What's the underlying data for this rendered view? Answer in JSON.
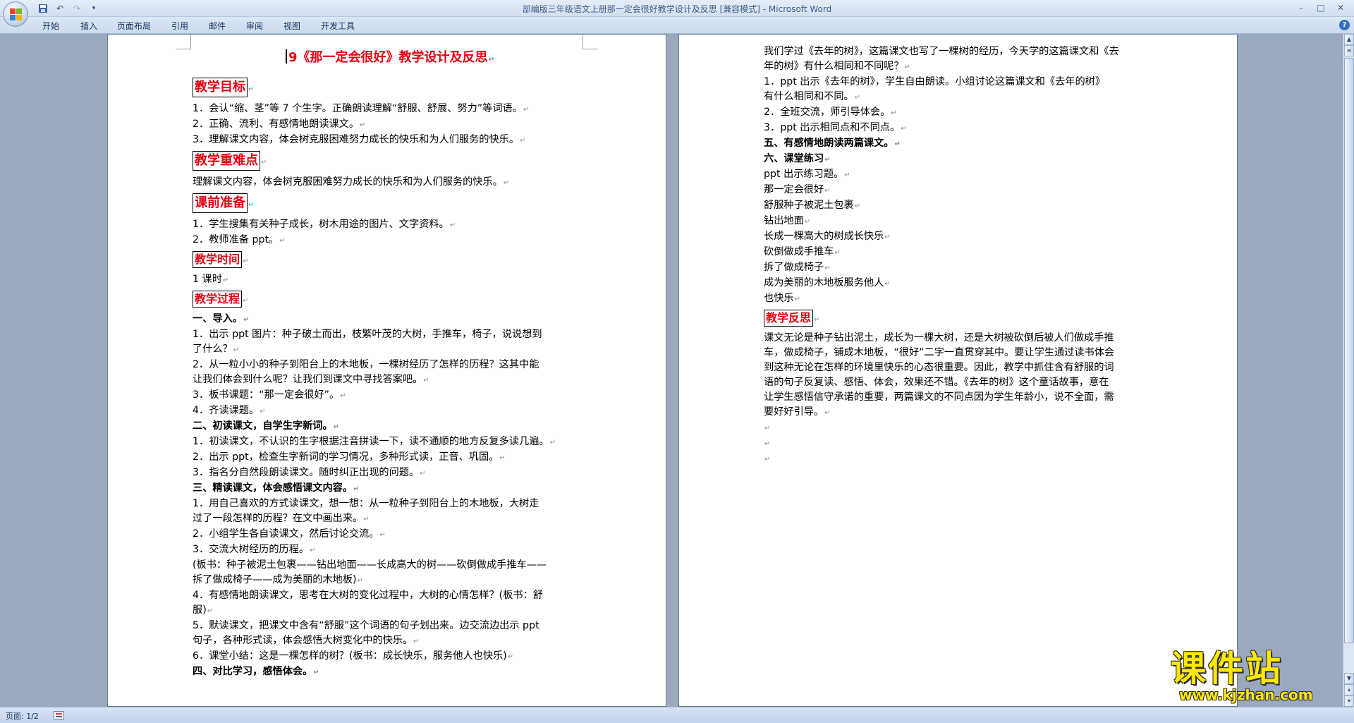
{
  "window": {
    "title": "部编版三年级语文上册那一定会很好教学设计及反思 [兼容模式] - Microsoft Word"
  },
  "ribbon": {
    "tabs": [
      "开始",
      "插入",
      "页面布局",
      "引用",
      "邮件",
      "审阅",
      "视图",
      "开发工具"
    ]
  },
  "page1": {
    "title": "9《那一定会很好》教学设计及反思",
    "sections": {
      "goals": {
        "heading": "教学目标",
        "lines": [
          "1．会认“缩、茎”等 7 个生字。正确朗读理解“舒服、舒展、努力”等词语。",
          "2．正确、流利、有感情地朗读课文。",
          "3．理解课文内容，体会树克服困难努力成长的快乐和为人们服务的快乐。"
        ]
      },
      "keypoints": {
        "heading": "教学重难点",
        "lines": [
          "理解课文内容，体会树克服困难努力成长的快乐和为人们服务的快乐。"
        ]
      },
      "prep": {
        "heading": "课前准备",
        "lines": [
          "1．学生搜集有关种子成长，树木用途的图片、文字资料。",
          "2．教师准备 ppt。"
        ]
      },
      "time": {
        "heading": "教学时间",
        "lines": [
          "1 课时"
        ]
      },
      "process": {
        "heading": "教学过程",
        "lines": [
          "一、导入。",
          "1．出示 ppt 图片：种子破土而出，枝繁叶茂的大树，手推车，椅子，说说想到",
          "了什么？",
          "2．从一粒小小的种子到阳台上的木地板，一棵树经历了怎样的历程？这其中能",
          "让我们体会到什么呢？让我们到课文中寻找答案吧。",
          "3．板书课题：“那一定会很好”。",
          "4．齐读课题。",
          "二、初读课文，自学生字新词。",
          "1．初读课文，不认识的生字根据注音拼读一下，读不通顺的地方反复多读几遍。",
          "2．出示 ppt，检查生字新词的学习情况，多种形式读，正音、巩固。",
          "3．指名分自然段朗读课文。随时纠正出现的问题。",
          "三、精读课文，体会感悟课文内容。",
          "1．用自己喜欢的方式读课文，想一想：从一粒种子到阳台上的木地板，大树走",
          "过了一段怎样的历程？在文中画出来。",
          "2．小组学生各自读课文，然后讨论交流。",
          "3．交流大树经历的历程。",
          "(板书：种子被泥土包裹——钻出地面——长成高大的树——砍倒做成手推车——",
          "拆了做成椅子——成为美丽的木地板)",
          "4．有感情地朗读课文，思考在大树的变化过程中，大树的心情怎样？(板书：舒",
          "服)",
          "5．默读课文，把课文中含有“舒服”这个词语的句子划出来。边交流边出示 ppt",
          "句子，各种形式读，体会感悟大树变化中的快乐。",
          "6．课堂小结：这是一棵怎样的树？(板书：成长快乐，服务他人也快乐)",
          "四、对比学习，感悟体会。"
        ]
      }
    }
  },
  "page2": {
    "lines": [
      "我们学过《去年的树》，这篇课文也写了一棵树的经历，今天学的这篇课文和《去",
      "年的树》有什么相同和不同呢？",
      "1．ppt 出示《去年的树》，学生自由朗读。小组讨论这篇课文和《去年的树》",
      "有什么相同和不同。",
      "2．全班交流，师引导体会。",
      "3．ppt 出示相同点和不同点。",
      "五、有感情地朗读两篇课文。",
      "六、课堂练习",
      "ppt 出示练习题。",
      "那一定会很好",
      "舒服种子被泥土包裹",
      "钻出地面",
      "长成一棵高大的树成长快乐",
      "砍倒做成手推车",
      "拆了做成椅子",
      "成为美丽的木地板服务他人",
      "也快乐"
    ],
    "reflection": {
      "heading": "教学反思",
      "lines": [
        "课文无论是种子钻出泥土，成长为一棵大树，还是大树被砍倒后被人们做成手推",
        "车，做成椅子，铺成木地板，“很好”二字一直贯穿其中。要让学生通过读书体会",
        "到这种无论在怎样的环境里快乐的心态很重要。因此，教学中抓住含有舒服的词",
        "语的句子反复读、感悟、体会，效果还不错。《去年的树》这个童话故事，意在",
        "让学生感悟信守承诺的重要，两篇课文的不同点因为学生年龄小，说不全面，需",
        "要好好引导。"
      ]
    }
  },
  "statusbar": {
    "page": "页面: 1/2"
  },
  "watermark": {
    "main": "课件站",
    "url": "www.kjzhan.com"
  },
  "colors": {
    "heading_red": "#e60012",
    "workspace": "#9aa9bd",
    "ribbon": "#cbdaee"
  }
}
